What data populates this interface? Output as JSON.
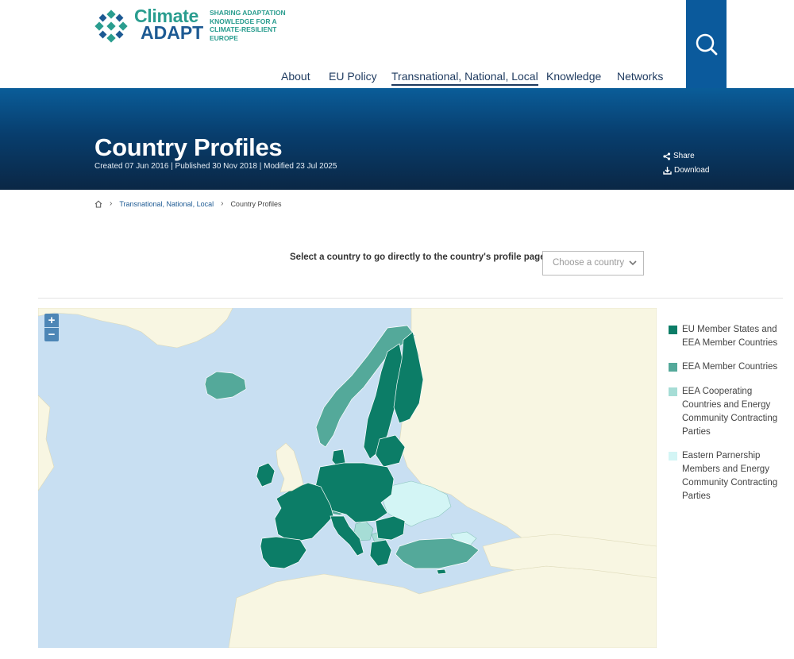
{
  "site": {
    "logo_line1": "Climate",
    "logo_line2": "ADAPT",
    "tagline": "SHARING ADAPTATION KNOWLEDGE FOR A CLIMATE-RESILIENT EUROPE"
  },
  "nav": {
    "items": [
      {
        "label": "About"
      },
      {
        "label": "EU Policy"
      },
      {
        "label": "Transnational, National, Local"
      },
      {
        "label": "Knowledge"
      },
      {
        "label": "Networks"
      }
    ],
    "active": "Transnational, National, Local"
  },
  "search": {
    "icon": "search-icon"
  },
  "hero": {
    "title": "Country Profiles",
    "meta": "Created 07 Jun 2016 | Published 30 Nov 2018 | Modified 23 Jul 2025",
    "share_label": "Share",
    "download_label": "Download"
  },
  "breadcrumb": {
    "home_icon": "home-icon",
    "parent": "Transnational, National, Local",
    "current": "Country Profiles"
  },
  "country_select": {
    "label": "Select a country to go directly to the country's profile page:",
    "placeholder": "Choose a country"
  },
  "map": {
    "zoom_in": "+",
    "zoom_out": "−",
    "colors": {
      "sea": "#c8dff2",
      "land": "#f8f6e2",
      "eu_member": "#0c7d67",
      "eea_member": "#54a99a",
      "eea_cooperating": "#a6ddd6",
      "eastern_partnership": "#d3f5f5"
    }
  },
  "legend": {
    "items": [
      {
        "label": "EU Member States and EEA Member Countries",
        "color": "#0c7d67"
      },
      {
        "label": "EEA Member Countries",
        "color": "#54a99a"
      },
      {
        "label": "EEA Cooperating Countries and Energy Community Contracting Parties",
        "color": "#a6ddd6"
      },
      {
        "label": "Eastern Parnership Members and Energy Community Contracting Parties",
        "color": "#d3f5f5"
      }
    ]
  }
}
